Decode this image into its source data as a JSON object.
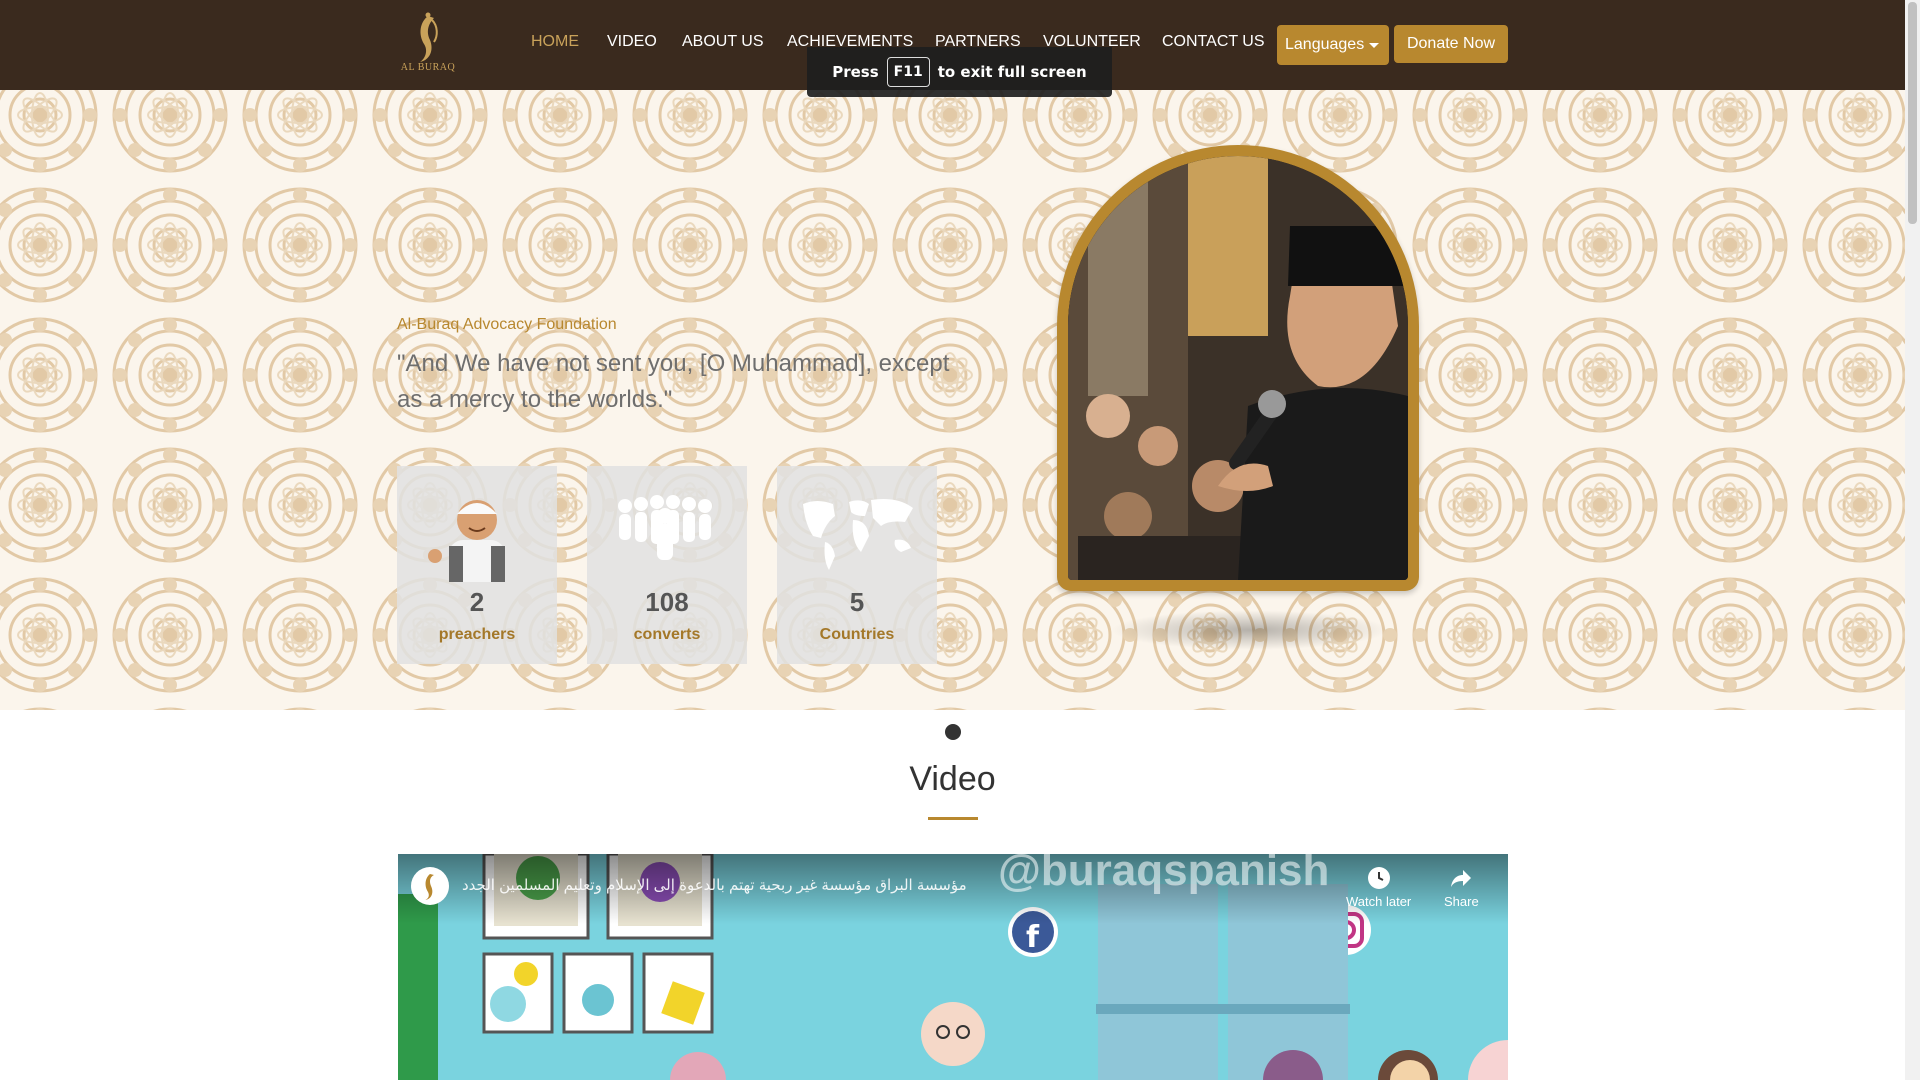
{
  "brand": {
    "logo_text": "AL BURAQ"
  },
  "nav": {
    "items": [
      "HOME",
      "VIDEO",
      "ABOUT US",
      "ACHIEVEMENTS",
      "PARTNERS",
      "VOLUNTEER",
      "CONTACT US"
    ],
    "active": "HOME",
    "languages_label": "Languages",
    "donate_label": "Donate Now"
  },
  "fullscreen_notice": {
    "press": "Press",
    "key": "F11",
    "rest": "to exit full screen"
  },
  "hero": {
    "subtitle": "Al-Buraq Advocacy Foundation",
    "quote": "\"And We have not sent you, [O Muhammad], except as a mercy to the worlds.\"",
    "stats": [
      {
        "value": "2",
        "label": "preachers",
        "icon": "preacher-icon"
      },
      {
        "value": "108",
        "label": "converts",
        "icon": "people-group-icon"
      },
      {
        "value": "5",
        "label": "Countries",
        "icon": "world-map-icon"
      }
    ]
  },
  "carousel": {
    "slides": 1,
    "active": 1
  },
  "video_section": {
    "title": "Video",
    "embed_title": "مؤسسة البراق مؤسسة غير ربحية تهتم بالدعوة إلى الإسلام وتعليم المسلمين الجدد",
    "overlay_handle": "@buraqspanish",
    "watch_later": "Watch later",
    "share": "Share"
  },
  "colors": {
    "nav_bg": "#3a2a1e",
    "accent": "#b8882f",
    "hero_bg": "#fbf5ec"
  }
}
